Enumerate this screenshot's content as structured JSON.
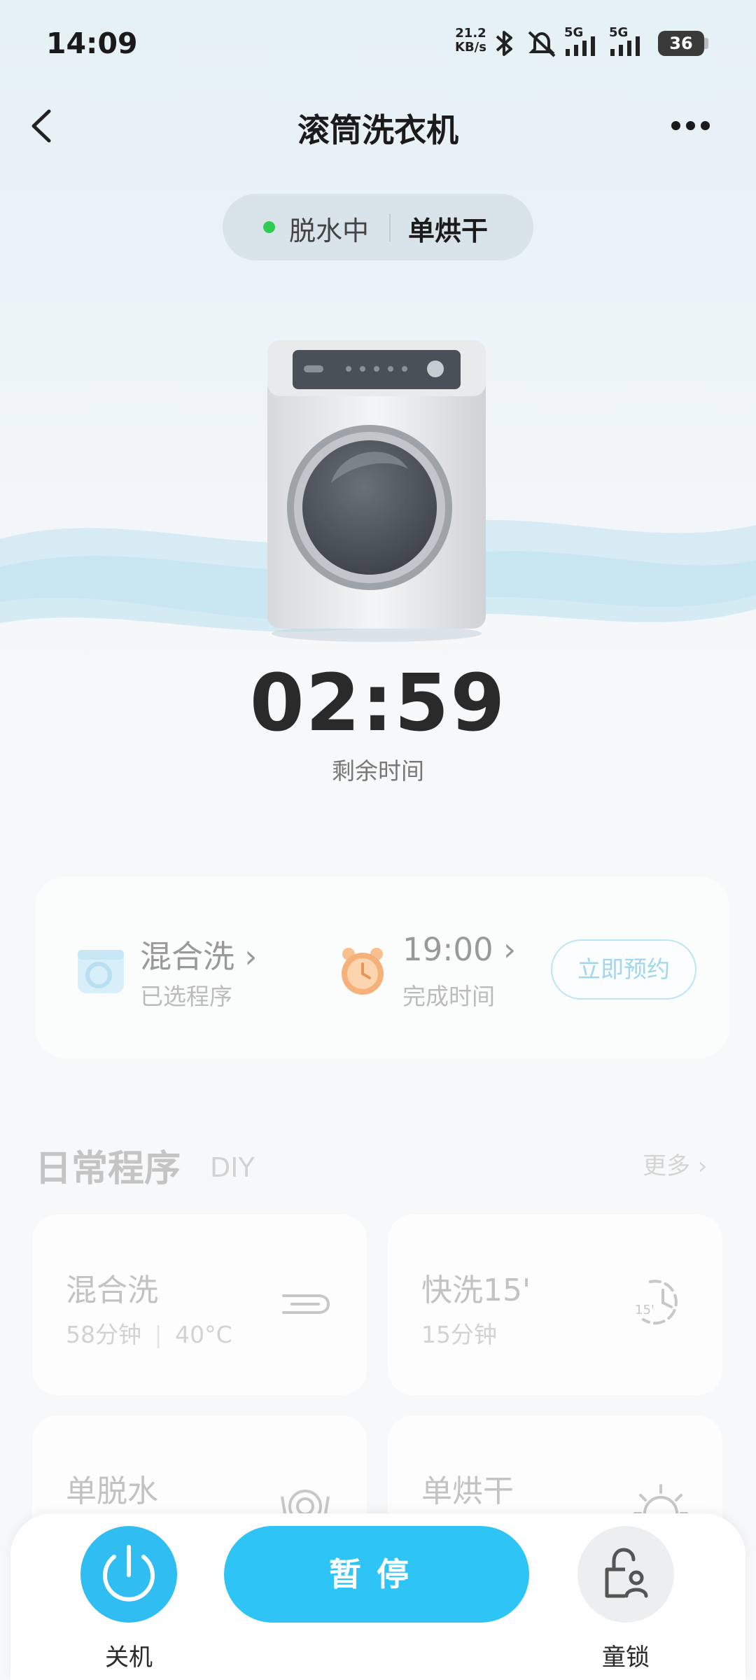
{
  "status_bar": {
    "time": "14:09",
    "net_speed_value": "21.2",
    "net_speed_unit": "KB/s",
    "signal_1": "5G",
    "signal_2": "5G",
    "battery": "36"
  },
  "header": {
    "title": "滚筒洗衣机"
  },
  "status_pill": {
    "state": "脱水中",
    "mode": "单烘干",
    "dot_color": "#2ecc53"
  },
  "timer": {
    "remaining": "02:59",
    "label": "剩余时间"
  },
  "schedule": {
    "program_name": "混合洗",
    "program_label": "已选程序",
    "finish_time": "19:00",
    "finish_label": "完成时间",
    "book_button": "立即预约"
  },
  "daily_programs": {
    "title": "日常程序",
    "diy": "DIY",
    "more": "更多",
    "tiles": [
      {
        "name": "混合洗",
        "duration": "58分钟",
        "temp": "40°C",
        "icon": "mixed-wash-icon"
      },
      {
        "name": "快洗15'",
        "duration": "15分钟",
        "icon": "quick-wash-icon"
      },
      {
        "name": "单脱水",
        "icon": "spin-icon"
      },
      {
        "name": "单烘干",
        "icon": "dry-icon"
      }
    ]
  },
  "bottom_bar": {
    "power_label": "关机",
    "pause_label": "暂停",
    "lock_label": "童锁"
  },
  "colors": {
    "accent": "#2ec4f6",
    "status_green": "#2ecc53",
    "alarm_orange": "#f6b07a"
  }
}
